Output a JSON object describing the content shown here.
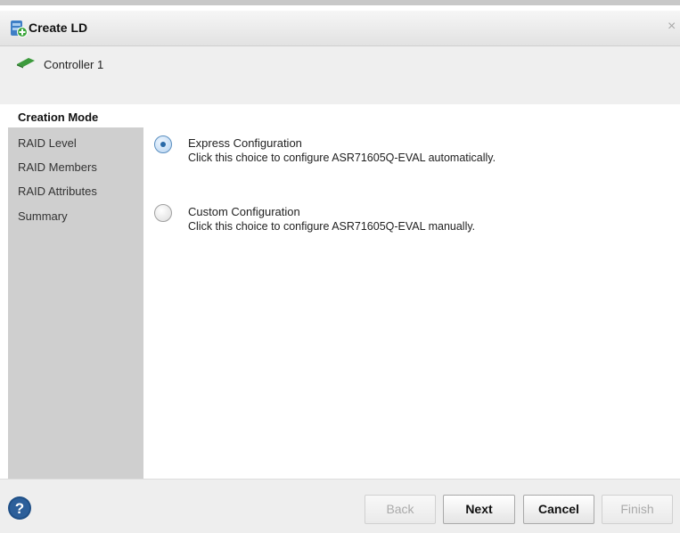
{
  "window": {
    "title": "Create LD",
    "close_glyph": "×",
    "title_icon": "create-ld-icon"
  },
  "controller": {
    "label": "Controller 1",
    "icon": "controller-card-icon"
  },
  "sidebar": {
    "items": [
      {
        "label": "Creation Mode",
        "active": true
      },
      {
        "label": "RAID Level",
        "active": false
      },
      {
        "label": "RAID Members",
        "active": false
      },
      {
        "label": "RAID Attributes",
        "active": false
      },
      {
        "label": "Summary",
        "active": false
      }
    ]
  },
  "options": [
    {
      "title": "Express Configuration",
      "description": "Click this choice to configure ASR71605Q-EVAL automatically.",
      "selected": true
    },
    {
      "title": "Custom Configuration",
      "description": "Click this choice to configure ASR71605Q-EVAL manually.",
      "selected": false
    }
  ],
  "footer": {
    "help_icon": "help-question-icon",
    "buttons": {
      "back": "Back",
      "next": "Next",
      "cancel": "Cancel",
      "finish": "Finish"
    }
  },
  "colors": {
    "accent": "#2a6aa8",
    "sidebar_bg": "#cfcfcf",
    "help_icon": "#1f4f86"
  }
}
